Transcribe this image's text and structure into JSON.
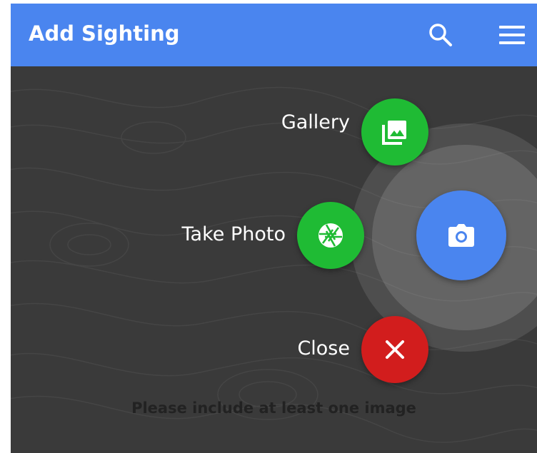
{
  "app_bar": {
    "title": "Add Sighting",
    "color": "#4a85ef",
    "actions": [
      {
        "icon": "search-icon"
      },
      {
        "icon": "menu-icon"
      }
    ]
  },
  "speed_dial": {
    "main_icon": "camera-icon",
    "main_color": "#4a85ef",
    "actions": [
      {
        "label": "Gallery",
        "icon": "gallery-icon",
        "color": "#1fbb34"
      },
      {
        "label": "Take Photo",
        "icon": "camera-shutter-icon",
        "color": "#1fbb34"
      },
      {
        "label": "Close",
        "icon": "close-icon",
        "color": "#d21d1d"
      }
    ]
  },
  "content": {
    "hint": "Please include at least one image",
    "background_color": "#3a3a3a"
  }
}
